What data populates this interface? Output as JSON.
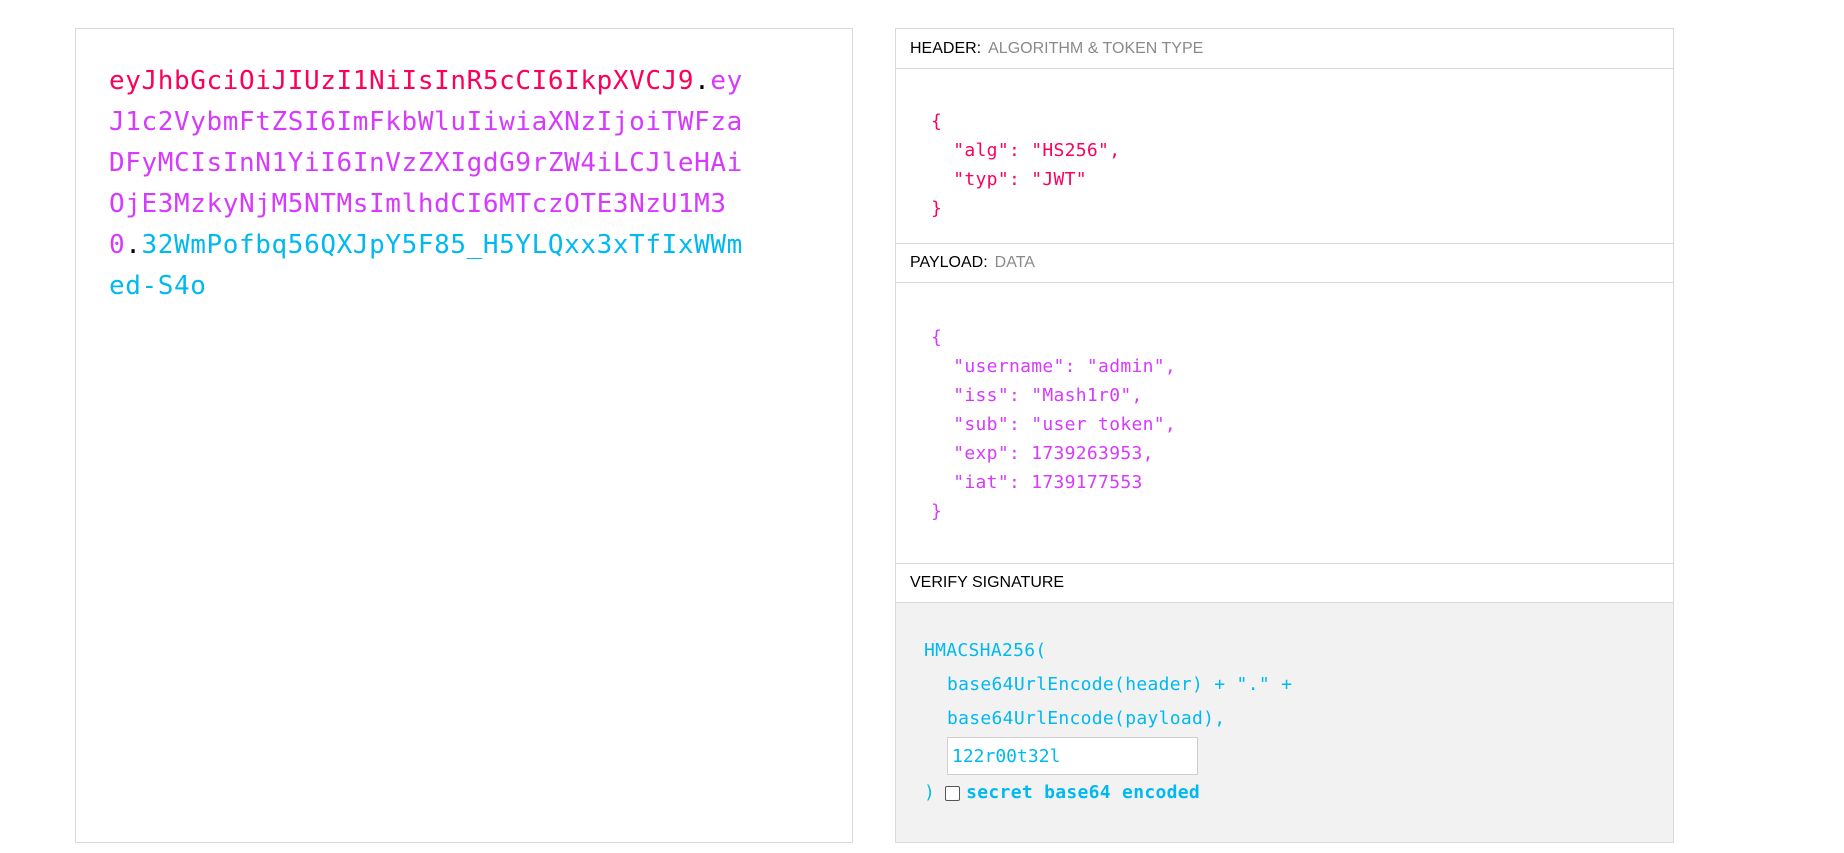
{
  "encoded": {
    "header": "eyJhbGciOiJIUzI1NiIsInR5cCI6IkpXVCJ9",
    "dot1": ".",
    "payload": "eyJ1c2VybmFtZSI6ImFkbWluIiwiaXNzIjoiTWFzaDFyMCIsInN1YiI6InVzZXIgdG9rZW4iLCJleHAiOjE3MzkyNjM5NTMsImlhdCI6MTczOTE3NzU1M30",
    "dot2": ".",
    "signature": "32WmPofbq56QXJpY5F85_H5YLQxx3xTfIxWWmed-S4o"
  },
  "decoded": {
    "header_section": {
      "title": "HEADER:",
      "subtitle": "ALGORITHM & TOKEN TYPE",
      "json": "{\n  \"alg\": \"HS256\",\n  \"typ\": \"JWT\"\n}"
    },
    "payload_section": {
      "title": "PAYLOAD:",
      "subtitle": "DATA",
      "json": "{\n  \"username\": \"admin\",\n  \"iss\": \"Mash1r0\",\n  \"sub\": \"user token\",\n  \"exp\": 1739263953,\n  \"iat\": 1739177553\n}"
    },
    "verify_section": {
      "title": "VERIFY SIGNATURE",
      "line1": "HMACSHA256(",
      "line2": "base64UrlEncode(header) + \".\" +",
      "line3": "base64UrlEncode(payload),",
      "secret_value": "122r00t32l",
      "close_paren": ")",
      "checkbox_label": "secret base64 encoded",
      "checkbox_checked": false
    }
  },
  "colors": {
    "header": "#fb015b",
    "payload": "#d63aff",
    "signature": "#00b9f1"
  }
}
